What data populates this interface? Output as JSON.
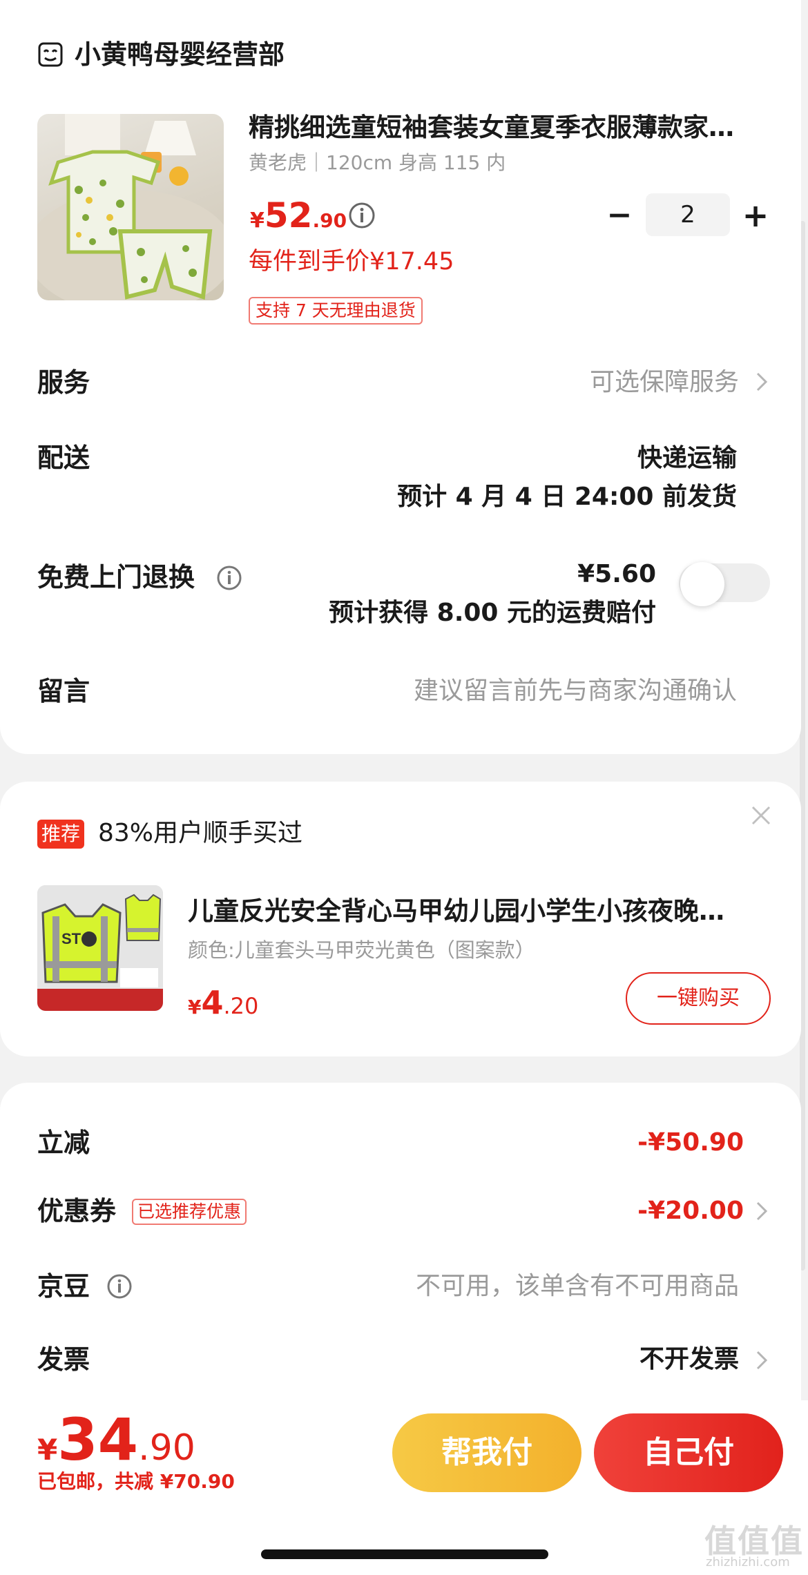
{
  "shop": {
    "name": "小黄鸭母婴经营部",
    "icon": "shop-icon"
  },
  "product": {
    "title": "精挑细选童短袖套装女童夏季衣服薄款家…",
    "spec": "黄老虎｜120cm 身高 115 内",
    "price_currency": "¥",
    "price_int": "52",
    "price_dec": ".90",
    "per_item_price": "每件到手价¥17.45",
    "return_tag": "支持 7 天无理由退货",
    "quantity": "2",
    "qty_minus": "−",
    "qty_plus": "+"
  },
  "rows": {
    "service_label": "服务",
    "service_value": "可选保障服务",
    "delivery_label": "配送",
    "delivery_method": "快递运输",
    "delivery_eta": "预计 4 月 4 日 24:00 前发货",
    "free_return_label": "免费上门退换",
    "free_return_price": "¥5.60",
    "free_return_note": "预计获得 8.00 元的运费赔付",
    "free_return_enabled": false,
    "message_label": "留言",
    "message_placeholder": "建议留言前先与商家沟通确认"
  },
  "recommendation": {
    "badge": "推荐",
    "text": "83%用户顺手买过",
    "title": "儿童反光安全背心马甲幼儿园小学生小孩夜晚…",
    "spec": "颜色:儿童套头马甲荧光黄色（图案款）",
    "price_currency": "¥",
    "price_int": "4",
    "price_dec": ".20",
    "buy_label": "一键购买"
  },
  "summary": {
    "discount_label": "立减",
    "discount_value": "-¥50.90",
    "coupon_label": "优惠券",
    "coupon_tag": "已选推荐优惠",
    "coupon_value": "-¥20.00",
    "jingdou_label": "京豆",
    "jingdou_value": "不可用，该单含有不可用商品",
    "invoice_label": "发票",
    "invoice_value": "不开发票"
  },
  "footer": {
    "total_currency": "¥",
    "total_int": "34",
    "total_dec": ".90",
    "total_sub": "已包邮，共减 ¥70.90",
    "help_pay_label": "帮我付",
    "self_pay_label": "自己付"
  },
  "watermark": {
    "logo": "值值值",
    "url": "zhizhizhi.com"
  },
  "colors": {
    "accent_red": "#e2231a",
    "help_yellow": "#f6c945",
    "muted_grey": "#9a9a9a"
  }
}
